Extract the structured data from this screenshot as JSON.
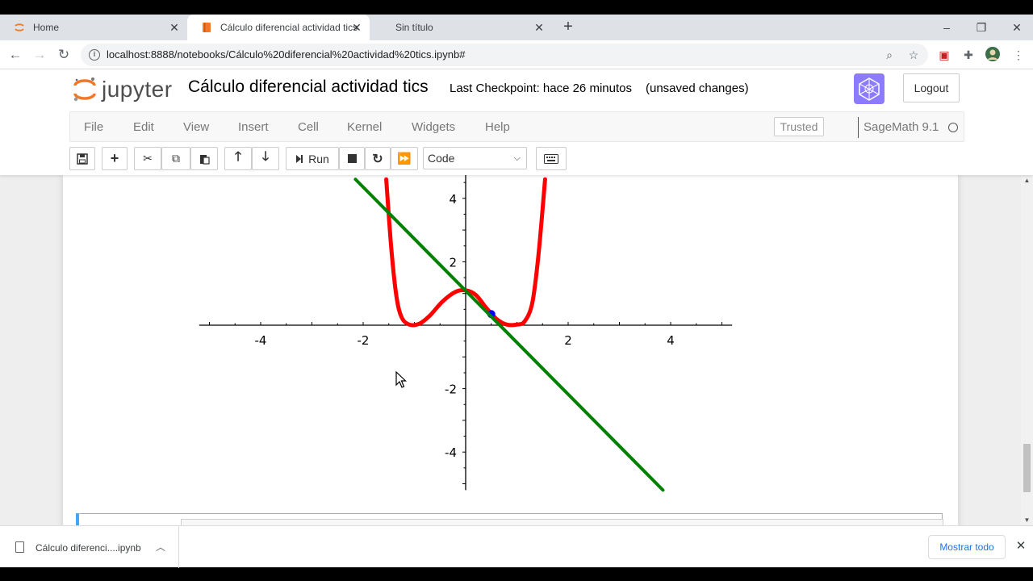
{
  "browser": {
    "tabs": [
      {
        "title": "Home",
        "icon": "jupyter-tab-icon"
      },
      {
        "title": "Cálculo diferencial actividad tics",
        "icon": "notebook-tab-icon"
      },
      {
        "title": "Sin título",
        "icon": ""
      }
    ],
    "url": "localhost:8888/notebooks/Cálculo%20diferencial%20actividad%20tics.ipynb#"
  },
  "jupyter": {
    "logo_text": "jupyter",
    "notebook_title": "Cálculo diferencial actividad tics",
    "checkpoint": "Last Checkpoint: hace 26 minutos",
    "unsaved": "(unsaved changes)",
    "logout_label": "Logout",
    "menu": [
      "File",
      "Edit",
      "View",
      "Insert",
      "Cell",
      "Kernel",
      "Widgets",
      "Help"
    ],
    "trusted_label": "Trusted",
    "kernel_name": "SageMath 9.1",
    "run_label": "Run",
    "cell_type": "Code"
  },
  "chart_data": {
    "type": "line",
    "x_ticks": [
      "-4",
      "-2",
      "2",
      "4"
    ],
    "y_ticks": [
      "4",
      "2",
      "-2",
      "-4"
    ],
    "xlim": [
      -5.2,
      5.2
    ],
    "ylim": [
      -5.2,
      4.6
    ],
    "series": [
      {
        "color": "#ff0000",
        "function": "curve",
        "points": [
          [
            -1.55,
            4.6
          ],
          [
            -1.45,
            2.4
          ],
          [
            -1.35,
            0.9
          ],
          [
            -1.25,
            0.25
          ],
          [
            -1.1,
            0.02
          ],
          [
            -0.9,
            0.05
          ],
          [
            -0.7,
            0.3
          ],
          [
            -0.45,
            0.75
          ],
          [
            -0.2,
            1.05
          ],
          [
            0,
            1.1
          ],
          [
            0.2,
            0.95
          ],
          [
            0.4,
            0.55
          ],
          [
            0.6,
            0.2
          ],
          [
            0.8,
            0.02
          ],
          [
            1.0,
            0.02
          ],
          [
            1.15,
            0.12
          ],
          [
            1.3,
            0.7
          ],
          [
            1.42,
            2.2
          ],
          [
            1.55,
            4.6
          ]
        ]
      },
      {
        "color": "#008000",
        "function": "tangent line",
        "points": [
          [
            -2.15,
            4.6
          ],
          [
            3.85,
            -5.2
          ]
        ]
      }
    ],
    "marked_point": {
      "x": 0.5,
      "y": 0.35,
      "color": "#0000ff"
    }
  },
  "download_bar": {
    "file_name": "Cálculo diferenci....ipynb",
    "show_all_label": "Mostrar todo"
  }
}
